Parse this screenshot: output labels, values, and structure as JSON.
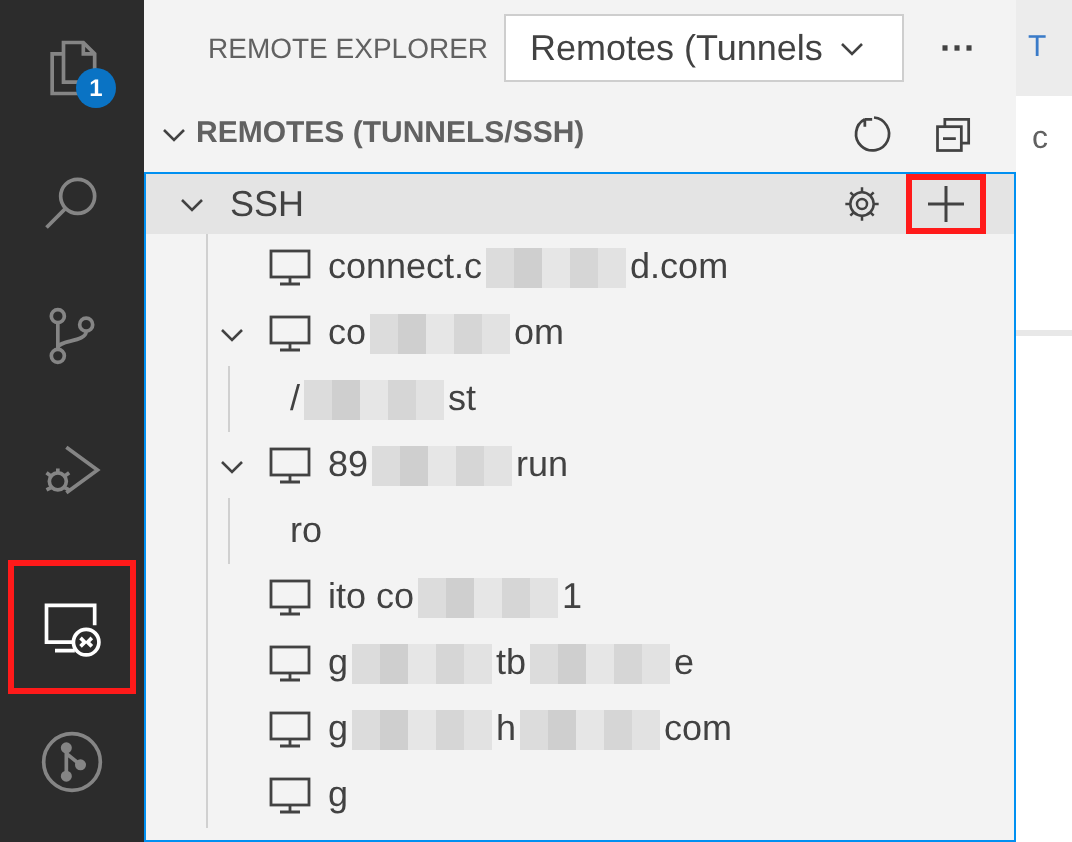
{
  "activity_bar": {
    "items": [
      {
        "kind": "files",
        "selected": false,
        "badge": "1",
        "highlighted": false
      },
      {
        "kind": "search",
        "selected": false,
        "highlighted": false
      },
      {
        "kind": "branch",
        "selected": false,
        "highlighted": false
      },
      {
        "kind": "debug",
        "selected": false,
        "highlighted": false
      },
      {
        "kind": "remote",
        "selected": true,
        "highlighted": true
      },
      {
        "kind": "graph",
        "selected": false,
        "highlighted": false
      }
    ]
  },
  "header": {
    "title": "REMOTE EXPLORER",
    "dropdown": "Remotes (Tunnels",
    "more": "···"
  },
  "section": {
    "title": "REMOTES (TUNNELS/SSH)",
    "expanded": true
  },
  "group": {
    "label": "SSH",
    "expanded": true,
    "add_highlighted": true,
    "hosts": [
      {
        "parts": [
          "connect.c",
          "d.com"
        ],
        "expanded": false
      },
      {
        "parts": [
          "co",
          "om"
        ],
        "expanded": true,
        "children": [
          {
            "parts": [
              "/",
              "st"
            ]
          }
        ]
      },
      {
        "parts": [
          "89",
          "run"
        ],
        "expanded": true,
        "children": [
          {
            "parts": [
              "ro"
            ]
          }
        ]
      },
      {
        "parts": [
          "ito co",
          "1"
        ],
        "expanded": false
      },
      {
        "parts": [
          "g",
          "tb",
          "e"
        ],
        "expanded": false
      },
      {
        "parts": [
          "g",
          "h",
          "com"
        ],
        "expanded": false
      },
      {
        "parts": [
          "g"
        ],
        "expanded": false
      }
    ]
  },
  "editor": {
    "tab": "T",
    "line": "c"
  }
}
